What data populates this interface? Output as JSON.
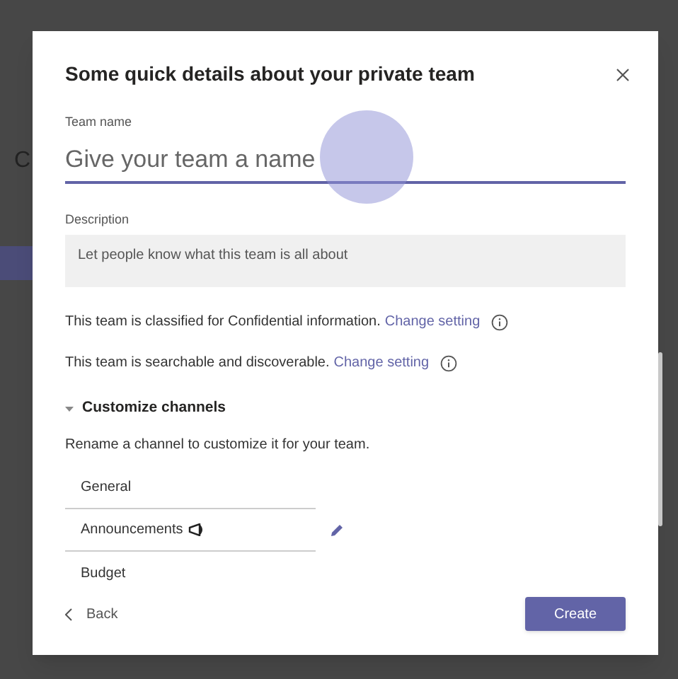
{
  "background": {
    "heading_fragment": "C"
  },
  "dialog": {
    "title": "Some quick details about your private team",
    "team_name": {
      "label": "Team name",
      "placeholder": "Give your team a name",
      "focused": true
    },
    "description": {
      "label": "Description",
      "placeholder": "Let people know what this team is all about"
    },
    "settings": [
      {
        "text": "This team is classified for Confidential information.",
        "link": "Change setting"
      },
      {
        "text": "This team is searchable and discoverable.",
        "link": "Change setting"
      }
    ],
    "channels_section": {
      "title": "Customize channels",
      "expanded": true,
      "hint": "Rename a channel to customize it for your team.",
      "channels": [
        {
          "name": "General",
          "underlined": true,
          "announcement": false,
          "edit_visible": false
        },
        {
          "name": "Announcements",
          "underlined": true,
          "announcement": true,
          "edit_visible": true
        },
        {
          "name": "Budget",
          "underlined": false,
          "announcement": false,
          "edit_visible": false
        }
      ]
    },
    "back": "Back",
    "create": "Create"
  }
}
